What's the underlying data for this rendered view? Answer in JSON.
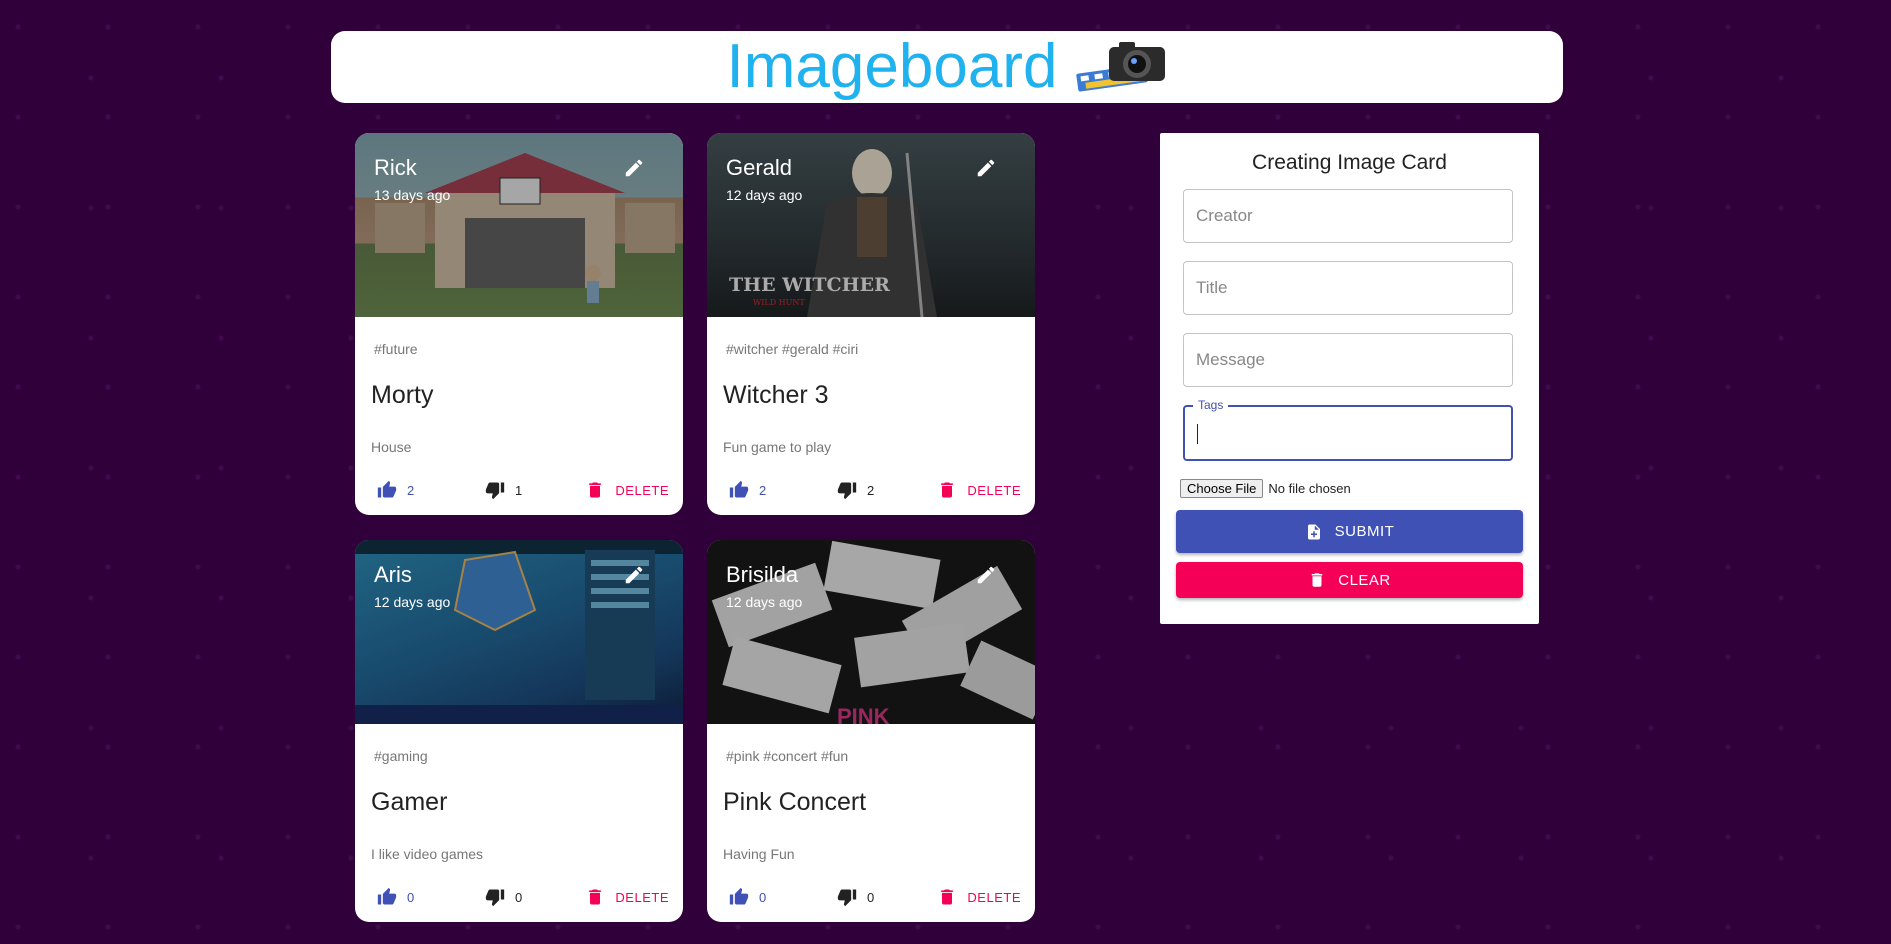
{
  "app": {
    "title": "Imageboard"
  },
  "cards": [
    {
      "creator": "Rick",
      "time": "13 days ago",
      "tags": "#future",
      "title": "Morty",
      "message": "House",
      "likes": "2",
      "dislikes": "1",
      "delete_label": "DELETE",
      "image": "rick-morty-house"
    },
    {
      "creator": "Gerald",
      "time": "12 days ago",
      "tags": "#witcher #gerald #ciri",
      "title": "Witcher 3",
      "message": "Fun game to play",
      "likes": "2",
      "dislikes": "2",
      "delete_label": "DELETE",
      "image": "witcher-3-poster",
      "image_text": "THE WITCHER",
      "image_subtext": "WILD HUNT"
    },
    {
      "creator": "Aris",
      "time": "12 days ago",
      "tags": "#gaming",
      "title": "Gamer",
      "message": "I like video games",
      "likes": "0",
      "dislikes": "0",
      "delete_label": "DELETE",
      "image": "gaming-monitor"
    },
    {
      "creator": "Brisilda",
      "time": "12 days ago",
      "tags": "#pink #concert #fun",
      "title": "Pink Concert",
      "message": "Having Fun",
      "likes": "0",
      "dislikes": "0",
      "delete_label": "DELETE",
      "image": "concert-tickets",
      "image_text": "PINK"
    }
  ],
  "form": {
    "title": "Creating Image Card",
    "creator_placeholder": "Creator",
    "title_placeholder": "Title",
    "message_placeholder": "Message",
    "tags_label": "Tags",
    "file_button": "Choose File",
    "file_status": "No file chosen",
    "submit_label": "SUBMIT",
    "clear_label": "CLEAR"
  },
  "colors": {
    "background": "#30003a",
    "brand": "#1fb2ee",
    "primary": "#3f51b5",
    "secondary": "#f50057"
  }
}
